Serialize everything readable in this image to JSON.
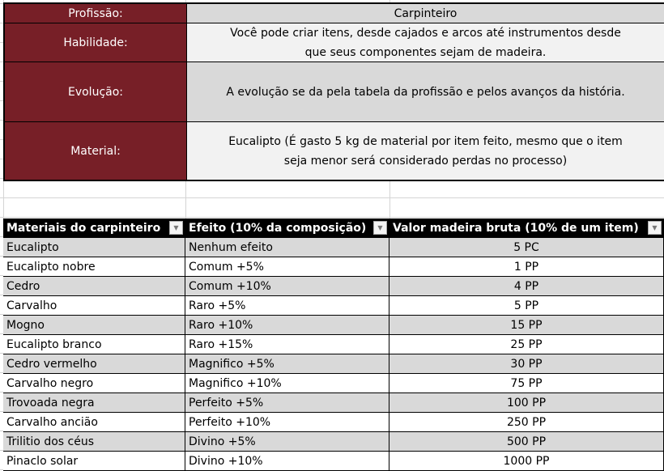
{
  "info": [
    {
      "label": "Profissão:",
      "value": "Carpinteiro"
    },
    {
      "label": "Habilidade:",
      "value": "Você pode criar itens, desde cajados e arcos até instrumentos desde que seus componentes sejam de madeira."
    },
    {
      "label": "Evolução:",
      "value": "A evolução se da pela tabela da profissão e pelos avanços da história."
    },
    {
      "label": "Material:",
      "value": "Eucalipto (É gasto 5 kg de material por item feito, mesmo que o item seja menor será considerado perdas no processo)"
    }
  ],
  "colors": {
    "label_bg": "#771f27",
    "stripe": "#d9d9d9",
    "header_bg": "#000000"
  },
  "table": {
    "headers": [
      "Materiais do carpinteiro",
      "Efeito (10% da composição)",
      "Valor madeira bruta (10% de um item)"
    ],
    "rows": [
      [
        "Eucalipto",
        "Nenhum efeito",
        "5 PC"
      ],
      [
        "Eucalipto nobre",
        "Comum +5%",
        "1 PP"
      ],
      [
        "Cedro",
        "Comum +10%",
        "4 PP"
      ],
      [
        "Carvalho",
        "Raro +5%",
        "5 PP"
      ],
      [
        "Mogno",
        "Raro +10%",
        "15 PP"
      ],
      [
        "Eucalipto branco",
        "Raro +15%",
        "25 PP"
      ],
      [
        "Cedro vermelho",
        "Magnifico +5%",
        "30 PP"
      ],
      [
        "Carvalho negro",
        "Magnifico +10%",
        "75 PP"
      ],
      [
        "Trovoada negra",
        "Perfeito +5%",
        "100 PP"
      ],
      [
        "Carvalho ancião",
        "Perfeito +10%",
        "250 PP"
      ],
      [
        "Trilitio dos céus",
        "Divino +5%",
        "500 PP"
      ],
      [
        "Pinaclo solar",
        "Divino +10%",
        "1000 PP"
      ]
    ]
  }
}
